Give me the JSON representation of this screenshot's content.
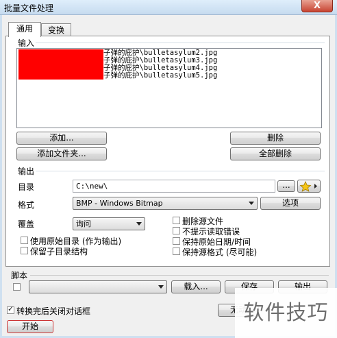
{
  "window": {
    "title": "批量文件处理",
    "close_symbol": "X"
  },
  "tabs": [
    {
      "label": "通用",
      "active": true
    },
    {
      "label": "变换",
      "active": false
    }
  ],
  "input_section": {
    "title": "输入",
    "files": [
      "子弹的庇护\\bulletasylum2.jpg",
      "子弹的庇护\\bulletasylum3.jpg",
      "子弹的庇护\\bulletasylum4.jpg",
      "子弹的庇护\\bulletasylum5.jpg"
    ],
    "add_button": "添加...",
    "add_folder_button": "添加文件夹...",
    "delete_button": "删除",
    "delete_all_button": "全部删除"
  },
  "output_section": {
    "title": "输出",
    "directory_label": "目录",
    "directory_value": "C:\\new\\",
    "browse_button": "...",
    "format_label": "格式",
    "format_value": "BMP - Windows Bitmap",
    "options_button": "选项",
    "overwrite_label": "覆盖",
    "overwrite_value": "询问",
    "checkboxes": {
      "use_original_dir": {
        "label": "使用原始目录 (作为输出)",
        "checked": false
      },
      "keep_subdirs": {
        "label": "保留子目录结构",
        "checked": false
      },
      "delete_source": {
        "label": "删除源文件",
        "checked": false
      },
      "no_read_errors": {
        "label": "不提示读取错误",
        "checked": false
      },
      "keep_date": {
        "label": "保持原始日期/时间",
        "checked": false
      },
      "keep_format": {
        "label": "保持源格式 (尽可能)",
        "checked": false
      }
    }
  },
  "script_section": {
    "title": "脚本",
    "load_button": "载入...",
    "save_button": "保存",
    "export_button": "输出"
  },
  "footer": {
    "close_after_convert": {
      "label": "转换完后关闭对话框",
      "checked": true
    },
    "start_button": "开始",
    "partial_button": "无动"
  },
  "watermark": "软件技巧",
  "colors": {
    "redaction": "#ff0000",
    "titlebar": "#c6dbef",
    "close": "#c84432",
    "star": "#f5c518"
  }
}
